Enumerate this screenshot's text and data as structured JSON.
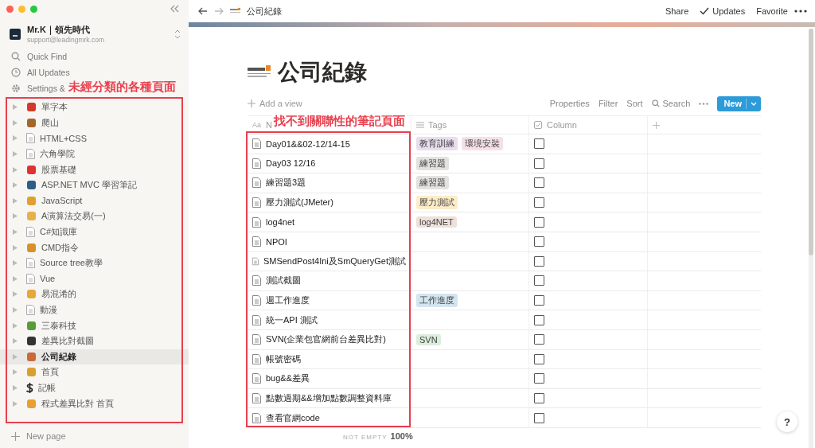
{
  "workspace": {
    "name": "Mr.K｜領先時代",
    "email": "support@leadingmrk.com"
  },
  "sidebar": {
    "nav": [
      {
        "label": "Quick Find",
        "kind": "search"
      },
      {
        "label": "All Updates",
        "kind": "clock"
      },
      {
        "label": "Settings &",
        "kind": "gear"
      }
    ],
    "pages": [
      {
        "label": "單字本",
        "kind": "emoji",
        "selected": false
      },
      {
        "label": "爬山",
        "kind": "emoji",
        "selected": false
      },
      {
        "label": "HTML+CSS",
        "kind": "page",
        "selected": false
      },
      {
        "label": "六角學院",
        "kind": "page",
        "selected": false
      },
      {
        "label": "股票基礎",
        "kind": "emoji",
        "selected": false
      },
      {
        "label": "ASP.NET MVC 學習筆記",
        "kind": "emoji",
        "selected": false
      },
      {
        "label": "JavaScript",
        "kind": "emoji",
        "selected": false
      },
      {
        "label": "A演算法交易(一)",
        "kind": "emoji",
        "selected": false
      },
      {
        "label": "C#知識庫",
        "kind": "page",
        "selected": false
      },
      {
        "label": "CMD指令",
        "kind": "emoji",
        "selected": false
      },
      {
        "label": "Source tree教學",
        "kind": "page",
        "selected": false
      },
      {
        "label": "Vue",
        "kind": "page",
        "selected": false
      },
      {
        "label": "易混淆的",
        "kind": "emoji",
        "selected": false
      },
      {
        "label": "動漫",
        "kind": "page",
        "selected": false
      },
      {
        "label": "三泰科技",
        "kind": "emoji",
        "selected": false
      },
      {
        "label": "差異比對截圖",
        "kind": "emoji",
        "selected": false
      },
      {
        "label": "公司紀錄",
        "kind": "emoji",
        "selected": true
      },
      {
        "label": "首頁",
        "kind": "emoji",
        "selected": false
      },
      {
        "label": "記帳",
        "kind": "dollar",
        "selected": false
      },
      {
        "label": "程式差異比對 首頁",
        "kind": "emoji",
        "selected": false
      }
    ],
    "new_page": "New page"
  },
  "topbar": {
    "breadcrumb": "公司紀錄",
    "actions": [
      "Share",
      "Updates",
      "Favorite"
    ]
  },
  "page": {
    "title": "公司紀錄",
    "toolbar": {
      "add_view": "Add a view",
      "actions": [
        "Properties",
        "Filter",
        "Sort",
        "Search"
      ],
      "new_button": "New"
    },
    "table": {
      "columns": [
        {
          "label": "N",
          "type_label": "Aa"
        },
        {
          "label": "Tags"
        },
        {
          "label": "Column"
        }
      ],
      "rows": [
        {
          "name": "Day01&&02-12/14-15",
          "tags": [
            {
              "label": "教育訓練",
              "color": "#e8deee"
            },
            {
              "label": "環境安裝",
              "color": "#f5e0e9"
            }
          ],
          "checked": false
        },
        {
          "name": "Day03 12/16",
          "tags": [
            {
              "label": "練習題",
              "color": "#e3e2e0"
            }
          ],
          "checked": false
        },
        {
          "name": "練習題3題",
          "tags": [
            {
              "label": "練習題",
              "color": "#e3e2e0"
            }
          ],
          "checked": false
        },
        {
          "name": "壓力測試(JMeter)",
          "tags": [
            {
              "label": "壓力測試",
              "color": "#fdecc8"
            }
          ],
          "checked": false
        },
        {
          "name": "log4net",
          "tags": [
            {
              "label": "log4NET",
              "color": "#eee0da"
            }
          ],
          "checked": false
        },
        {
          "name": "NPOI",
          "tags": [],
          "checked": false
        },
        {
          "name": "SMSendPost4Ini及SmQueryGet測試",
          "tags": [],
          "checked": false
        },
        {
          "name": "測試截圖",
          "tags": [],
          "checked": false
        },
        {
          "name": "週工作進度",
          "tags": [
            {
              "label": "工作進度",
              "color": "#d3e5ef"
            }
          ],
          "checked": false
        },
        {
          "name": "統一API 測試",
          "tags": [],
          "checked": false
        },
        {
          "name": "SVN(企業包官網前台差異比對)",
          "tags": [
            {
              "label": "SVN",
              "color": "#dbeddb"
            }
          ],
          "checked": false
        },
        {
          "name": "帳號密碼",
          "tags": [],
          "checked": false
        },
        {
          "name": "bug&&差異",
          "tags": [],
          "checked": false
        },
        {
          "name": "點數過期&&增加點數調整資料庫",
          "tags": [],
          "checked": false
        },
        {
          "name": "查看官網code",
          "tags": [],
          "checked": false
        }
      ],
      "footer": {
        "label": "NOT EMPTY",
        "value": "100%"
      }
    }
  },
  "annotations": [
    {
      "text": "未經分類的各種頁面"
    },
    {
      "text": "找不到關聯性的筆記頁面"
    }
  ],
  "help": "?"
}
